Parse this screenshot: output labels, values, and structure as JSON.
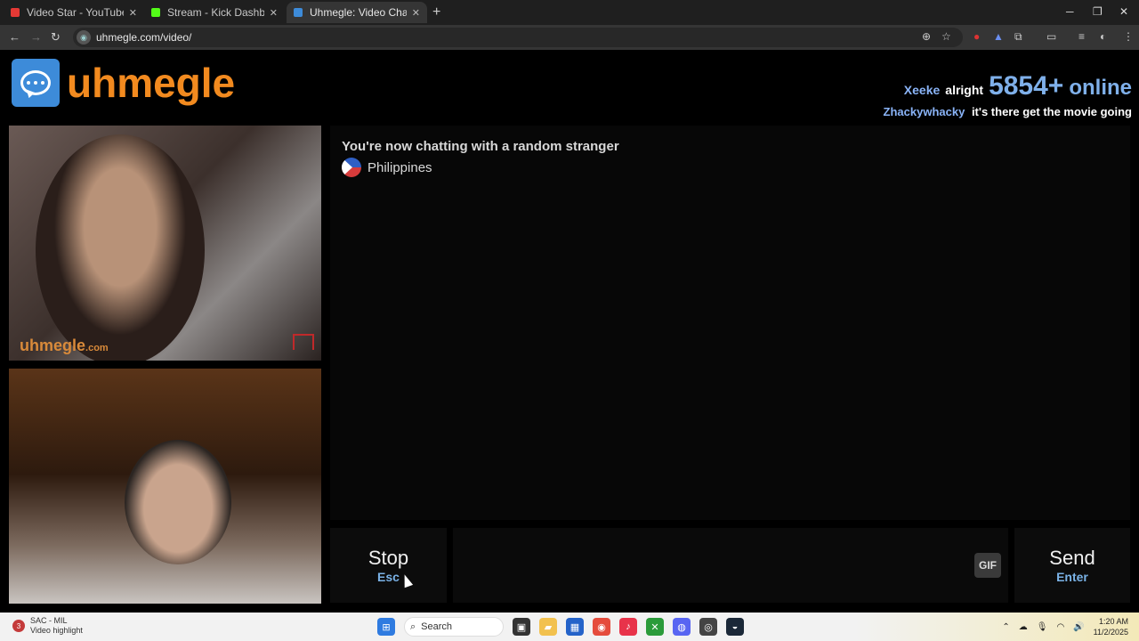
{
  "browser": {
    "tabs": [
      {
        "label": "Video Star - YouTube",
        "icon": "youtube-icon",
        "color": "#e53935"
      },
      {
        "label": "Stream - Kick Dashboard",
        "icon": "kick-icon",
        "color": "#53fc18"
      },
      {
        "label": "Uhmegle: Video Chat | Ran",
        "icon": "uhmegle-icon",
        "color": "#3d8bd9"
      }
    ],
    "url": "uhmegle.com/video/"
  },
  "site": {
    "brand": "uhmegle",
    "online_user": "Xeeke",
    "online_msg": "alright",
    "online_count": "5854+",
    "online_label": "online",
    "ticker_user": "Zhackywhacky",
    "ticker_msg": "it's there get the movie going"
  },
  "videos": {
    "watermark": "uhmegle",
    "watermark_suffix": ".com"
  },
  "chat": {
    "status": "You're now chatting with a random stranger",
    "country": "Philippines"
  },
  "controls": {
    "stop_label": "Stop",
    "stop_key": "Esc",
    "gif_label": "GIF",
    "send_label": "Send",
    "send_key": "Enter"
  },
  "taskbar": {
    "notif_count": "3",
    "app_title": "SAC - MIL",
    "app_subtitle": "Video highlight",
    "search": "Search",
    "time": "1:20 AM",
    "date": "11/2/2025"
  },
  "colors": {
    "brand_orange": "#f28a1f",
    "accent_blue": "#7ab2e6"
  }
}
